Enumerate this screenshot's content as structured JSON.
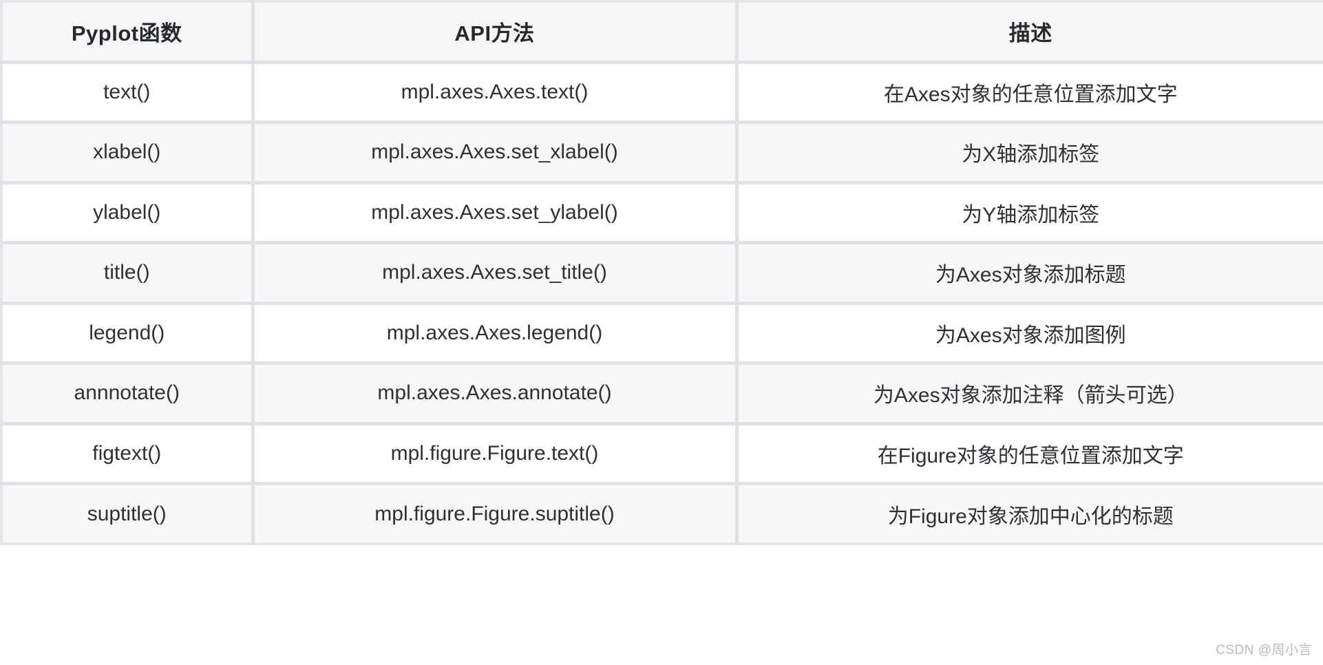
{
  "table": {
    "headers": [
      "Pyplot函数",
      "API方法",
      "描述"
    ],
    "rows": [
      {
        "pyplot": "text()",
        "api": "mpl.axes.Axes.text()",
        "description": "在Axes对象的任意位置添加文字"
      },
      {
        "pyplot": "xlabel()",
        "api": "mpl.axes.Axes.set_xlabel()",
        "description": "为X轴添加标签"
      },
      {
        "pyplot": "ylabel()",
        "api": "mpl.axes.Axes.set_ylabel()",
        "description": "为Y轴添加标签"
      },
      {
        "pyplot": "title()",
        "api": "mpl.axes.Axes.set_title()",
        "description": "为Axes对象添加标题"
      },
      {
        "pyplot": "legend()",
        "api": "mpl.axes.Axes.legend()",
        "description": "为Axes对象添加图例"
      },
      {
        "pyplot": "annnotate()",
        "api": "mpl.axes.Axes.annotate()",
        "description": "为Axes对象添加注释（箭头可选）"
      },
      {
        "pyplot": "figtext()",
        "api": "mpl.figure.Figure.text()",
        "description": "在Figure对象的任意位置添加文字"
      },
      {
        "pyplot": "suptitle()",
        "api": "mpl.figure.Figure.suptitle()",
        "description": "为Figure对象添加中心化的标题"
      }
    ]
  },
  "watermark": {
    "text": "CSDN @周小言"
  },
  "colors": {
    "border": "#dee2e6",
    "header_background": "#f6f6f7",
    "row_shaded_background": "#f7f7f8",
    "row_plain_background": "#ffffff",
    "text": "#2f2f35",
    "header_text": "#24292e",
    "watermark_text": "#b6bac0"
  }
}
